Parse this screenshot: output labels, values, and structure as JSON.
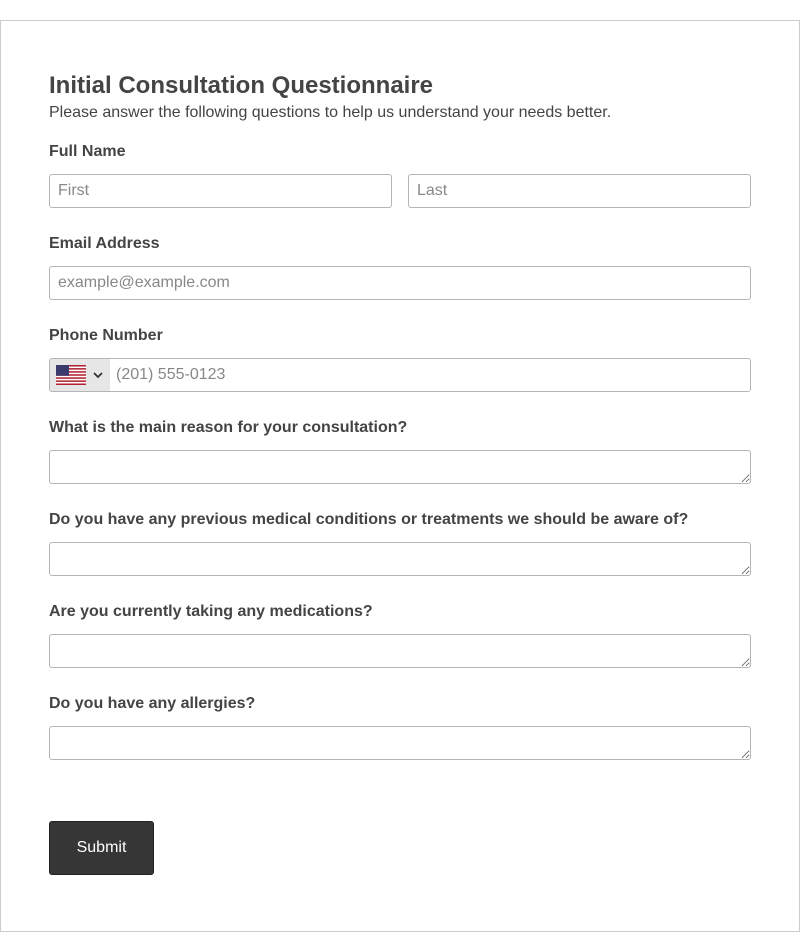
{
  "form": {
    "title": "Initial Consultation Questionnaire",
    "subtitle": "Please answer the following questions to help us understand your needs better."
  },
  "fields": {
    "full_name": {
      "label": "Full Name",
      "first_placeholder": "First",
      "last_placeholder": "Last",
      "first_value": "",
      "last_value": ""
    },
    "email": {
      "label": "Email Address",
      "placeholder": "example@example.com",
      "value": ""
    },
    "phone": {
      "label": "Phone Number",
      "country_icon": "us-flag-icon",
      "placeholder": "(201) 555-0123",
      "value": ""
    },
    "reason": {
      "label": "What is the main reason for your consultation?",
      "value": ""
    },
    "conditions": {
      "label": "Do you have any previous medical conditions or treatments we should be aware of?",
      "value": ""
    },
    "medications": {
      "label": "Are you currently taking any medications?",
      "value": ""
    },
    "allergies": {
      "label": "Do you have any allergies?",
      "value": ""
    }
  },
  "submit": {
    "label": "Submit"
  },
  "colors": {
    "text": "#444444",
    "border": "#b5b5b5",
    "button_bg": "#363636",
    "button_text": "#ffffff",
    "country_select_bg": "#e6e6e6"
  }
}
